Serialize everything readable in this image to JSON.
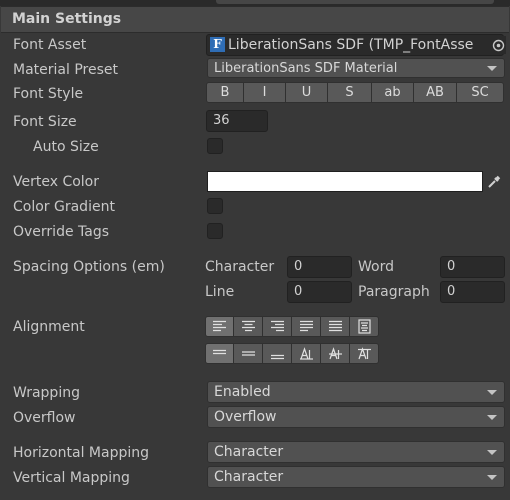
{
  "section_title": "Main Settings",
  "font_asset": {
    "label": "Font Asset",
    "value": "LiberationSans SDF (TMP_FontAsse",
    "asset_icon": "F"
  },
  "material_preset": {
    "label": "Material Preset",
    "value": "LiberationSans SDF Material"
  },
  "font_style": {
    "label": "Font Style",
    "buttons": [
      "B",
      "I",
      "U",
      "S",
      "ab",
      "AB",
      "SC"
    ]
  },
  "font_size": {
    "label": "Font Size",
    "value": "36"
  },
  "auto_size": {
    "label": "Auto Size",
    "checked": false
  },
  "vertex_color": {
    "label": "Vertex Color",
    "color": "#ffffff"
  },
  "color_gradient": {
    "label": "Color Gradient",
    "checked": false
  },
  "override_tags": {
    "label": "Override Tags",
    "checked": false
  },
  "spacing": {
    "label": "Spacing Options (em)",
    "character_label": "Character",
    "character_value": "0",
    "word_label": "Word",
    "word_value": "0",
    "line_label": "Line",
    "line_value": "0",
    "paragraph_label": "Paragraph",
    "paragraph_value": "0"
  },
  "alignment": {
    "label": "Alignment",
    "horizontal": [
      "align-left-icon",
      "align-center-icon",
      "align-right-icon",
      "justify-icon",
      "flush-icon",
      "geometry-center-icon"
    ],
    "horizontal_selected": 0,
    "vertical": [
      "align-top-icon",
      "align-middle-icon",
      "align-bottom-icon",
      "align-baseline-icon",
      "align-midline-icon",
      "align-capline-icon"
    ],
    "vertical_selected": 0
  },
  "wrapping": {
    "label": "Wrapping",
    "value": "Enabled"
  },
  "overflow": {
    "label": "Overflow",
    "value": "Overflow"
  },
  "horizontal_mapping": {
    "label": "Horizontal Mapping",
    "value": "Character"
  },
  "vertical_mapping": {
    "label": "Vertical Mapping",
    "value": "Character"
  },
  "colors": {
    "panel_bg": "#383838",
    "header_bg": "#474747",
    "field_bg": "#2a2a2a",
    "button_bg": "#595959",
    "selected_button_bg": "#707070",
    "asset_icon_blue": "#2f6db5"
  }
}
